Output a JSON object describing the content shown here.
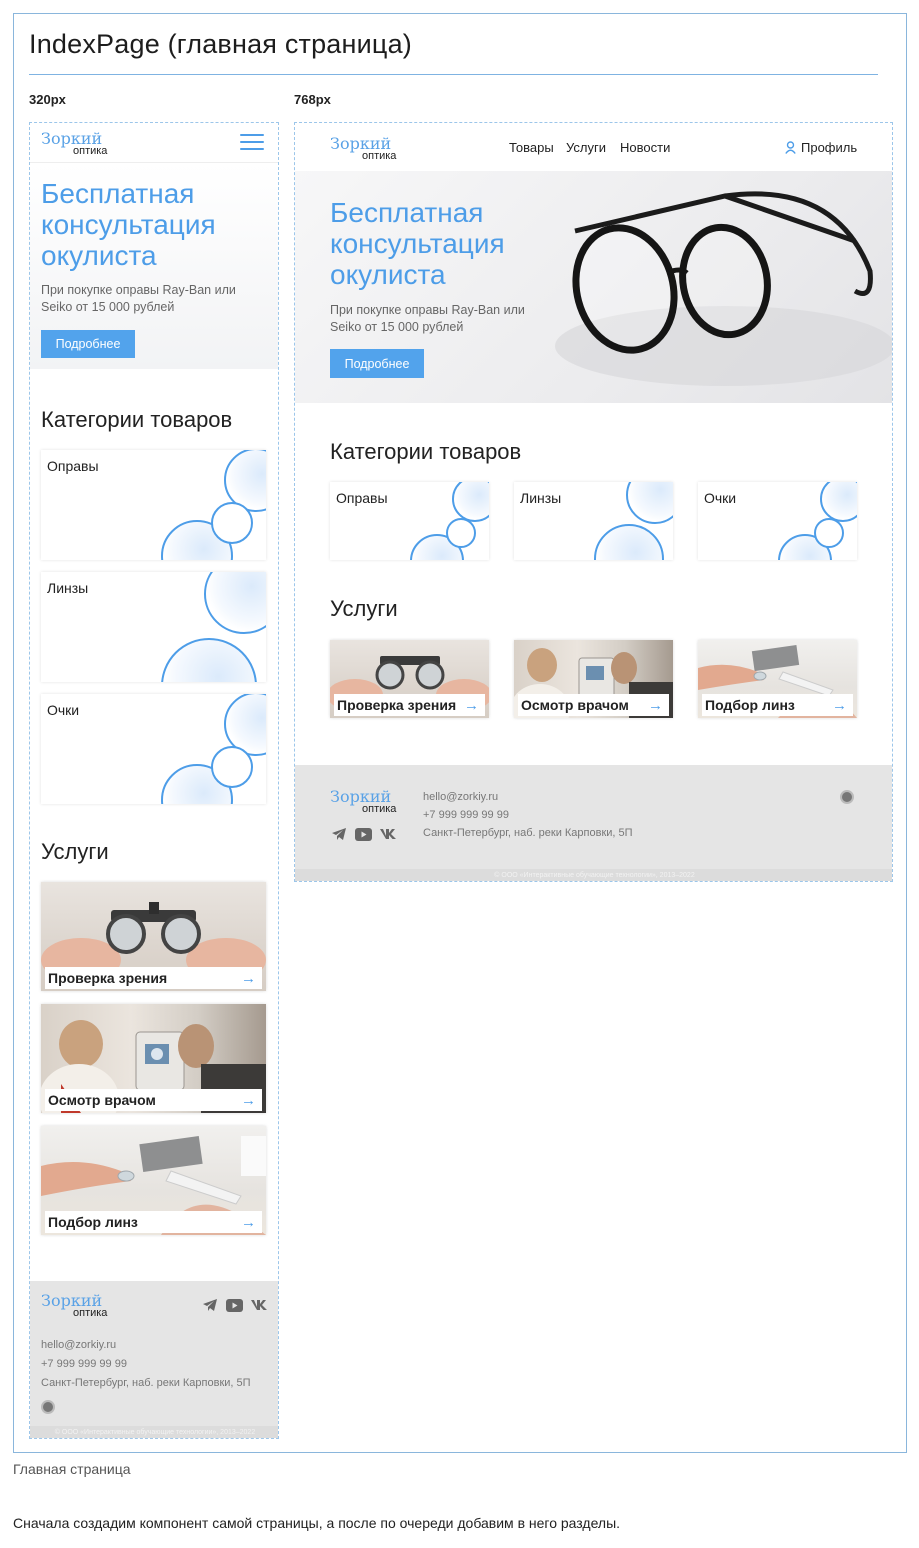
{
  "frame": {
    "title": "IndexPage (главная страница)"
  },
  "breakpoints": {
    "mobile": "320px",
    "tablet": "768px"
  },
  "logo": {
    "line1": "Зоркий",
    "line2": "оптика"
  },
  "nav": {
    "goods": "Товары",
    "services": "Услуги",
    "news": "Новости",
    "profile": "Профиль"
  },
  "hero": {
    "title_line1": "Бесплатная",
    "title_line2": "консультация",
    "title_line3": "окулиста",
    "text_line1": "При покупке оправы Ray-Ban или",
    "text_line2": "Seiko от 15 000 рублей",
    "button": "Подробнее"
  },
  "categories": {
    "title": "Категории товаров",
    "items": [
      "Оправы",
      "Линзы",
      "Очки"
    ]
  },
  "services": {
    "title": "Услуги",
    "items": [
      "Проверка зрения",
      "Осмотр врачом",
      "Подбор линз"
    ]
  },
  "footer": {
    "email": "hello@zorkiy.ru",
    "phone": "+7 999 999 99 99",
    "address": "Санкт-Петербург, наб. реки Карповки, 5П",
    "copyright": "© ООО «Интерактивные обучающие технологии», 2013–2022"
  },
  "icons": {
    "arrow": "→",
    "telegram": "telegram-icon",
    "youtube": "youtube-icon",
    "vk": "vk-icon",
    "menu": "menu-icon",
    "user": "user-icon"
  },
  "caption": "Главная страница",
  "paragraph": "Сначала создадим компонент самой страницы, а после по очереди добавим в него разделы.",
  "colors": {
    "accent": "#4d9de8",
    "footer_bg": "#e5e5e5",
    "frame_border": "#8ab6dc"
  }
}
